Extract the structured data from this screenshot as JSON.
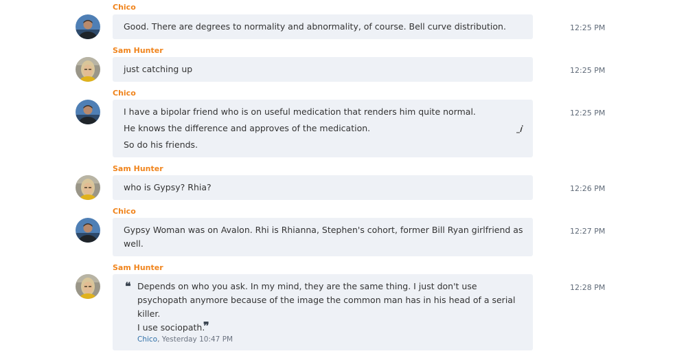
{
  "colors": {
    "sender_name": "#f0841c",
    "bubble_bg": "#eef1f6",
    "timestamp": "#5f6a78",
    "quote_author": "#2e6fa8"
  },
  "messages": [
    {
      "sender": "Chico",
      "avatar": "chico",
      "lines": [
        "Good.  There are degrees to normality and abnormality, of course.  Bell curve distribution."
      ],
      "time": "12:25 PM"
    },
    {
      "sender": "Sam Hunter",
      "avatar": "sam",
      "lines": [
        "just catching up"
      ],
      "time": "12:25 PM"
    },
    {
      "sender": "Chico",
      "avatar": "chico",
      "lines": [
        "I have a bipolar friend who is on useful medication that renders him quite normal.",
        "He knows the difference and approves of the medication.",
        "So do his friends."
      ],
      "time": "12:25 PM",
      "edit_icon": "edit-pencil-icon"
    },
    {
      "sender": "Sam Hunter",
      "avatar": "sam",
      "lines": [
        "who is Gypsy?  Rhia?"
      ],
      "time": "12:26 PM"
    },
    {
      "sender": "Chico",
      "avatar": "chico",
      "lines": [
        "Gypsy Woman was on Avalon.  Rhi is Rhianna, Stephen's cohort, former Bill Ryan girlfriend as",
        "well."
      ],
      "time": "12:27 PM"
    },
    {
      "sender": "Sam Hunter",
      "avatar": "sam",
      "quote": {
        "open_mark": "❝",
        "close_mark": "❞",
        "lines": [
          "Depends on who you ask.  In my mind, they are the same thing.  I just don't use",
          "psychopath anymore because of the image the common man has in his head of a serial",
          "killer.",
          "I use sociopath."
        ],
        "author": "Chico",
        "timestamp": "Yesterday 10:47 PM"
      },
      "time": "12:28 PM"
    }
  ]
}
